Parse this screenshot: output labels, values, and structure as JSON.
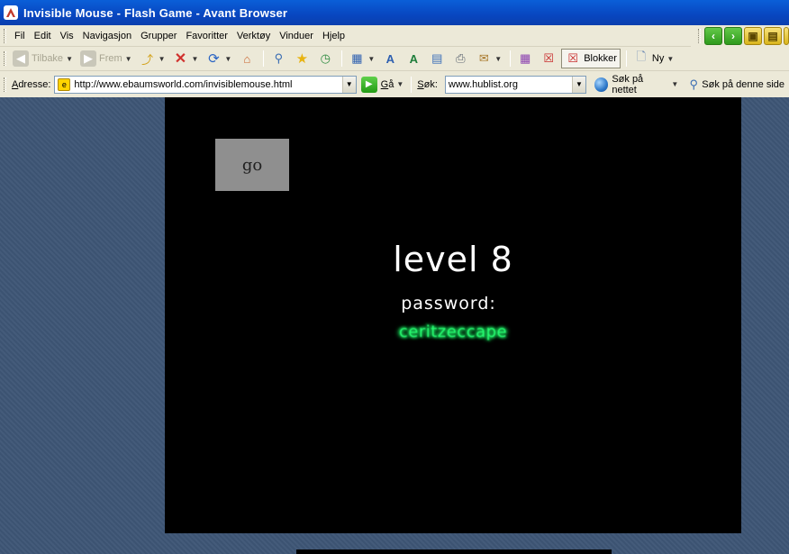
{
  "window": {
    "title": "Invisible Mouse - Flash Game - Avant Browser"
  },
  "menubar": {
    "items": [
      "Fil",
      "Edit",
      "Vis",
      "Navigasjon",
      "Grupper",
      "Favoritter",
      "Verktøy",
      "Vinduer",
      "Hjelp"
    ]
  },
  "toolbar": {
    "back_label": "Tilbake",
    "forward_label": "Frem",
    "blokker_label": "Blokker",
    "ny_label": "Ny"
  },
  "addressbar": {
    "label_underlined": "A",
    "label_rest": "dresse:",
    "url": "http://www.ebaumsworld.com/invisiblemouse.html",
    "go_underlined": "G",
    "go_rest": "å"
  },
  "searchbar": {
    "label_underlined": "S",
    "label_rest": "øk:",
    "value": "www.hublist.org",
    "search_web_label": "Søk på nettet",
    "search_page_label": "Søk på denne side"
  },
  "game": {
    "go_button_label": "go",
    "level_text": "level 8",
    "password_label": "password:",
    "password_value": "ceritzeccape"
  }
}
